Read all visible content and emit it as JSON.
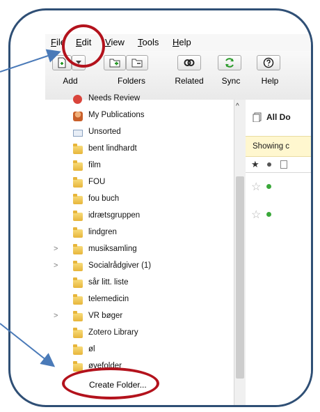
{
  "menubar": {
    "items": [
      {
        "prefix": "",
        "underlined": "F",
        "rest": "ile"
      },
      {
        "prefix": "",
        "underlined": "E",
        "rest": "dit"
      },
      {
        "prefix": "",
        "underlined": "V",
        "rest": "iew"
      },
      {
        "prefix": "",
        "underlined": "T",
        "rest": "ools"
      },
      {
        "prefix": "",
        "underlined": "H",
        "rest": "elp"
      }
    ]
  },
  "toolbar": {
    "add_label": "Add",
    "folders_label": "Folders",
    "related_label": "Related",
    "sync_label": "Sync",
    "help_label": "Help"
  },
  "collections": {
    "items": [
      {
        "label": "Needs Review",
        "icon": "needs-review-icon",
        "twisty": false
      },
      {
        "label": "My Publications",
        "icon": "my-publications-icon",
        "twisty": false
      },
      {
        "label": "Unsorted",
        "icon": "unsorted-icon",
        "twisty": false
      },
      {
        "label": "bent lindhardt",
        "icon": "folder-icon",
        "twisty": false
      },
      {
        "label": "film",
        "icon": "folder-icon",
        "twisty": false
      },
      {
        "label": "FOU",
        "icon": "folder-icon",
        "twisty": false
      },
      {
        "label": "fou buch",
        "icon": "folder-icon",
        "twisty": false
      },
      {
        "label": "idrætsgruppen",
        "icon": "folder-icon",
        "twisty": false
      },
      {
        "label": "lindgren",
        "icon": "folder-icon",
        "twisty": false
      },
      {
        "label": "musiksamling",
        "icon": "folder-icon",
        "twisty": true
      },
      {
        "label": "Socialrådgiver (1)",
        "icon": "folder-icon",
        "twisty": true
      },
      {
        "label": "sår litt. liste",
        "icon": "folder-icon",
        "twisty": false
      },
      {
        "label": "telemedicin",
        "icon": "folder-icon",
        "twisty": false
      },
      {
        "label": "VR bøger",
        "icon": "folder-icon",
        "twisty": true
      },
      {
        "label": "Zotero Library",
        "icon": "folder-icon",
        "twisty": false
      },
      {
        "label": "øl",
        "icon": "folder-icon",
        "twisty": false
      },
      {
        "label": "øvefolder",
        "icon": "folder-icon",
        "twisty": false
      }
    ],
    "create_folder": "Create Folder..."
  },
  "items_pane": {
    "title": "All Do",
    "showing_text": "Showing c"
  },
  "colors": {
    "frame": "#2f4f75",
    "annotation_oval": "#b3121c",
    "arrow": "#4a7ab8",
    "status_dot": "#3aa83a"
  }
}
